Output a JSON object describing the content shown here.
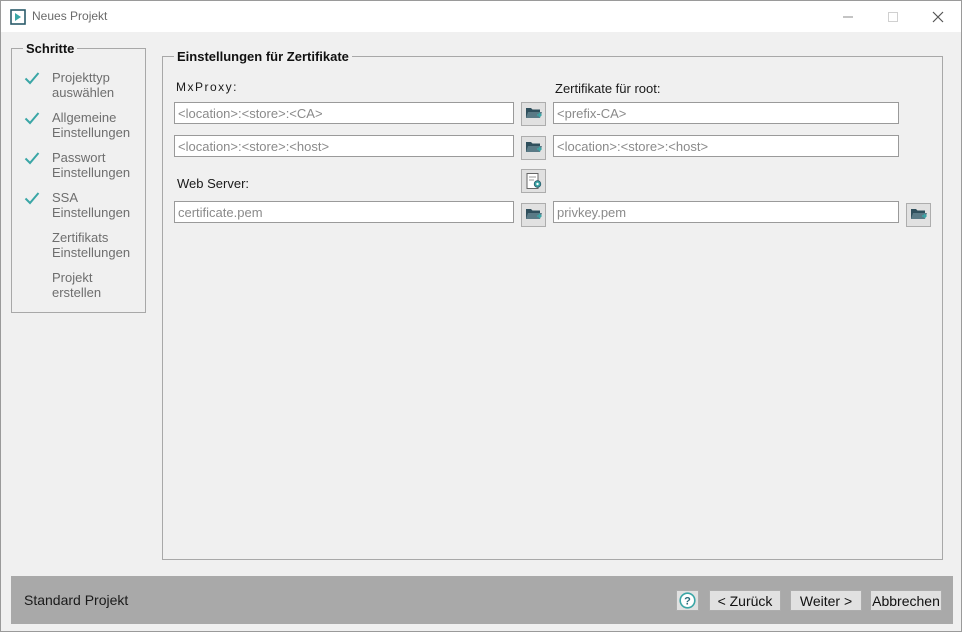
{
  "window": {
    "title": "Neues Projekt"
  },
  "steps": {
    "legend": "Schritte",
    "items": [
      {
        "label": "Projekttyp\nauswählen",
        "done": true
      },
      {
        "label": "Allgemeine\nEinstellungen",
        "done": true
      },
      {
        "label": "Passwort\nEinstellungen",
        "done": true
      },
      {
        "label": "SSA\nEinstellungen",
        "done": true
      },
      {
        "label": "Zertifikats\nEinstellungen",
        "done": false
      },
      {
        "label": "Projekt\nerstellen",
        "done": false
      }
    ]
  },
  "settings": {
    "legend": "Einstellungen für Zertifikate",
    "mxproxy_label": "MxProxy:",
    "root_label": "Zertifikate für root:",
    "webserver_label": "Web Server:",
    "mx_ca_placeholder": "<location>:<store>:<CA>",
    "mx_host_placeholder": "<location>:<store>:<host>",
    "root_ca_placeholder": "<prefix-CA>",
    "root_host_placeholder": "<location>:<store>:<host>",
    "web_cert_placeholder": "certificate.pem",
    "web_key_placeholder": "privkey.pem"
  },
  "icons": {
    "folder": "folder-open-icon",
    "certificate": "certificate-icon",
    "check": "checkmark-icon",
    "help": "help-icon",
    "accent_check": "#3aa6a6",
    "accent_folder": "#2f4f5c"
  },
  "footer": {
    "project_type": "Standard Projekt",
    "back_label": "< Zurück",
    "next_label": "Weiter >",
    "cancel_label": "Abbrechen"
  }
}
